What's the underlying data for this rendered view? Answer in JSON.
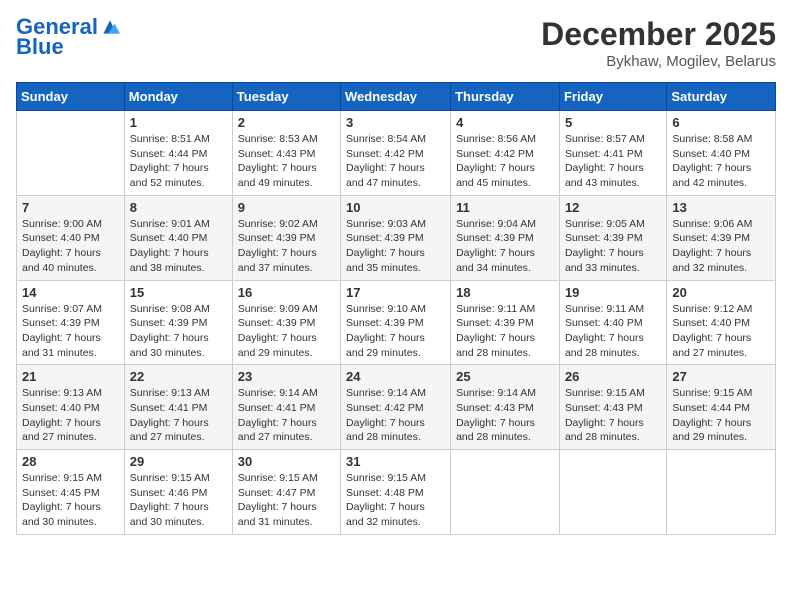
{
  "header": {
    "logo_text_general": "General",
    "logo_text_blue": "Blue",
    "month_title": "December 2025",
    "subtitle": "Bykhaw, Mogilev, Belarus"
  },
  "days_of_week": [
    "Sunday",
    "Monday",
    "Tuesday",
    "Wednesday",
    "Thursday",
    "Friday",
    "Saturday"
  ],
  "weeks": [
    [
      {
        "day": "",
        "info": ""
      },
      {
        "day": "1",
        "info": "Sunrise: 8:51 AM\nSunset: 4:44 PM\nDaylight: 7 hours\nand 52 minutes."
      },
      {
        "day": "2",
        "info": "Sunrise: 8:53 AM\nSunset: 4:43 PM\nDaylight: 7 hours\nand 49 minutes."
      },
      {
        "day": "3",
        "info": "Sunrise: 8:54 AM\nSunset: 4:42 PM\nDaylight: 7 hours\nand 47 minutes."
      },
      {
        "day": "4",
        "info": "Sunrise: 8:56 AM\nSunset: 4:42 PM\nDaylight: 7 hours\nand 45 minutes."
      },
      {
        "day": "5",
        "info": "Sunrise: 8:57 AM\nSunset: 4:41 PM\nDaylight: 7 hours\nand 43 minutes."
      },
      {
        "day": "6",
        "info": "Sunrise: 8:58 AM\nSunset: 4:40 PM\nDaylight: 7 hours\nand 42 minutes."
      }
    ],
    [
      {
        "day": "7",
        "info": "Sunrise: 9:00 AM\nSunset: 4:40 PM\nDaylight: 7 hours\nand 40 minutes."
      },
      {
        "day": "8",
        "info": "Sunrise: 9:01 AM\nSunset: 4:40 PM\nDaylight: 7 hours\nand 38 minutes."
      },
      {
        "day": "9",
        "info": "Sunrise: 9:02 AM\nSunset: 4:39 PM\nDaylight: 7 hours\nand 37 minutes."
      },
      {
        "day": "10",
        "info": "Sunrise: 9:03 AM\nSunset: 4:39 PM\nDaylight: 7 hours\nand 35 minutes."
      },
      {
        "day": "11",
        "info": "Sunrise: 9:04 AM\nSunset: 4:39 PM\nDaylight: 7 hours\nand 34 minutes."
      },
      {
        "day": "12",
        "info": "Sunrise: 9:05 AM\nSunset: 4:39 PM\nDaylight: 7 hours\nand 33 minutes."
      },
      {
        "day": "13",
        "info": "Sunrise: 9:06 AM\nSunset: 4:39 PM\nDaylight: 7 hours\nand 32 minutes."
      }
    ],
    [
      {
        "day": "14",
        "info": "Sunrise: 9:07 AM\nSunset: 4:39 PM\nDaylight: 7 hours\nand 31 minutes."
      },
      {
        "day": "15",
        "info": "Sunrise: 9:08 AM\nSunset: 4:39 PM\nDaylight: 7 hours\nand 30 minutes."
      },
      {
        "day": "16",
        "info": "Sunrise: 9:09 AM\nSunset: 4:39 PM\nDaylight: 7 hours\nand 29 minutes."
      },
      {
        "day": "17",
        "info": "Sunrise: 9:10 AM\nSunset: 4:39 PM\nDaylight: 7 hours\nand 29 minutes."
      },
      {
        "day": "18",
        "info": "Sunrise: 9:11 AM\nSunset: 4:39 PM\nDaylight: 7 hours\nand 28 minutes."
      },
      {
        "day": "19",
        "info": "Sunrise: 9:11 AM\nSunset: 4:40 PM\nDaylight: 7 hours\nand 28 minutes."
      },
      {
        "day": "20",
        "info": "Sunrise: 9:12 AM\nSunset: 4:40 PM\nDaylight: 7 hours\nand 27 minutes."
      }
    ],
    [
      {
        "day": "21",
        "info": "Sunrise: 9:13 AM\nSunset: 4:40 PM\nDaylight: 7 hours\nand 27 minutes."
      },
      {
        "day": "22",
        "info": "Sunrise: 9:13 AM\nSunset: 4:41 PM\nDaylight: 7 hours\nand 27 minutes."
      },
      {
        "day": "23",
        "info": "Sunrise: 9:14 AM\nSunset: 4:41 PM\nDaylight: 7 hours\nand 27 minutes."
      },
      {
        "day": "24",
        "info": "Sunrise: 9:14 AM\nSunset: 4:42 PM\nDaylight: 7 hours\nand 28 minutes."
      },
      {
        "day": "25",
        "info": "Sunrise: 9:14 AM\nSunset: 4:43 PM\nDaylight: 7 hours\nand 28 minutes."
      },
      {
        "day": "26",
        "info": "Sunrise: 9:15 AM\nSunset: 4:43 PM\nDaylight: 7 hours\nand 28 minutes."
      },
      {
        "day": "27",
        "info": "Sunrise: 9:15 AM\nSunset: 4:44 PM\nDaylight: 7 hours\nand 29 minutes."
      }
    ],
    [
      {
        "day": "28",
        "info": "Sunrise: 9:15 AM\nSunset: 4:45 PM\nDaylight: 7 hours\nand 30 minutes."
      },
      {
        "day": "29",
        "info": "Sunrise: 9:15 AM\nSunset: 4:46 PM\nDaylight: 7 hours\nand 30 minutes."
      },
      {
        "day": "30",
        "info": "Sunrise: 9:15 AM\nSunset: 4:47 PM\nDaylight: 7 hours\nand 31 minutes."
      },
      {
        "day": "31",
        "info": "Sunrise: 9:15 AM\nSunset: 4:48 PM\nDaylight: 7 hours\nand 32 minutes."
      },
      {
        "day": "",
        "info": ""
      },
      {
        "day": "",
        "info": ""
      },
      {
        "day": "",
        "info": ""
      }
    ]
  ]
}
